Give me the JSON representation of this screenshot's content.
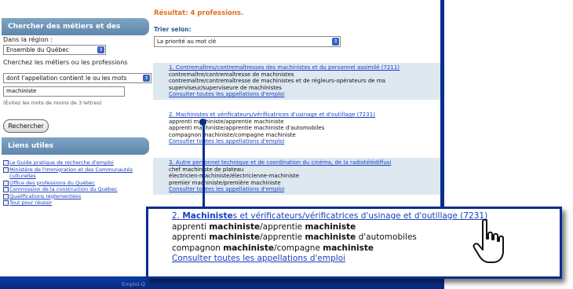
{
  "sidebar": {
    "search_title": "Chercher des métiers et des professions",
    "region_label": "Dans la région :",
    "region_value": "Ensemble du Québec",
    "search_label": "Cherchez les métiers ou les professions",
    "mode_value": "dont l'appellation contient le ou les mots",
    "query_value": "machiniste",
    "hint": "(Évitez les mots de moins de 3 lettres)",
    "search_button": "Rechercher",
    "links_title": "Liens utiles",
    "links": [
      "Le Guide pratique de recherche d'emploi",
      "Ministère de l'Immigration et des Communautés culturelles",
      "Office des professions du Québec",
      "Commission de la construction du Québec",
      "Qualifications réglementées",
      "Tout pour réussir"
    ]
  },
  "main": {
    "result_count": "Résultat: 4 professions.",
    "sort_label": "Trier selon:",
    "sort_value": "La priorité au mot clé",
    "results": [
      {
        "title": "1. Contremaîtres/contremaîtresses des machinistes et du personnel assimilé (7211)",
        "lines": [
          "contremaître/contremaîtresse de machinistes",
          "contremaître/contremaîtresse de machinistes et de régleurs-opérateurs de ma",
          "superviseur/superviseure de machinistes"
        ],
        "link": "Consulter toutes les appellations d'emploi"
      },
      {
        "title": "2. Machinistes et vérificateurs/vérificatrices d'usinage et d'outillage (7231)",
        "lines": [
          "apprenti machiniste/apprentie machiniste",
          "apprenti machiniste/apprentie machiniste d'automobiles",
          "compagnon machiniste/compagne machiniste"
        ],
        "link": "Consulter toutes les appellations d'emploi"
      },
      {
        "title": "3. Autre personnel technique et de coordination du cinéma, de la radiotélédiffusi",
        "lines": [
          "chef machiniste de plateau",
          "électricien-machiniste/électricienne-machiniste",
          "premier machiniste/première machiniste"
        ],
        "link": "Consulter toutes les appellations d'emploi"
      }
    ],
    "footer": "Emploi-Q"
  },
  "callout": {
    "title_num": "2. ",
    "title_bold": "Machiniste",
    "title_rest": "s et vérificateurs/vérificatrices d'usinage et d'outillage (7231)",
    "lines": [
      [
        "apprenti ",
        "machiniste",
        "/apprentie ",
        "machiniste",
        ""
      ],
      [
        "apprenti ",
        "machiniste",
        "/apprentie ",
        "machiniste",
        " d'automobiles"
      ],
      [
        "compagnon ",
        "machiniste",
        "/compagne ",
        "machiniste",
        ""
      ]
    ],
    "link": "Consulter toutes les appellations d'emploi"
  },
  "colors": {
    "frame_blue": "#0a2e8f",
    "result_orange": "#e0701c",
    "link_blue": "#1a40c0",
    "row_bg": "#dde8f1"
  }
}
